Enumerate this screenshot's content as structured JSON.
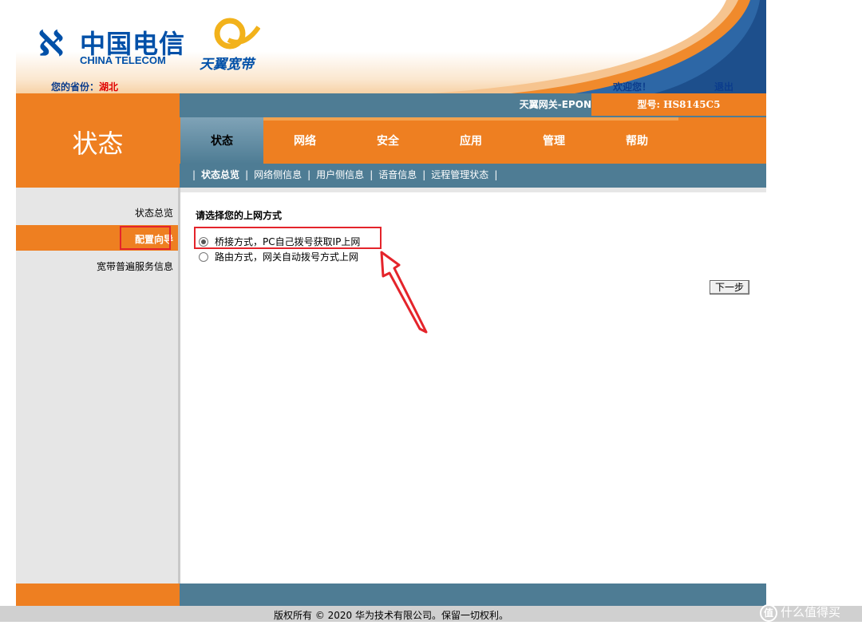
{
  "header": {
    "logo_cn": "中国电信",
    "logo_en": "CHINA TELECOM",
    "brand_text": "天翼宽带",
    "province_label": "您的省份：",
    "province_value": "湖北",
    "welcome": "欢迎您！",
    "logout": "退出"
  },
  "device": {
    "gateway_name": "天翼网关-EPON",
    "model": "型号: HS8145C5"
  },
  "section": {
    "title": "状态"
  },
  "nav": {
    "tabs": [
      {
        "label": "状态",
        "active": true
      },
      {
        "label": "网络"
      },
      {
        "label": "安全"
      },
      {
        "label": "应用"
      },
      {
        "label": "管理"
      },
      {
        "label": "帮助"
      }
    ]
  },
  "subnav": {
    "items": [
      "状态总览",
      "网络侧信息",
      "用户侧信息",
      "语音信息",
      "远程管理状态"
    ],
    "active": "状态总览"
  },
  "sidebar": {
    "items": [
      {
        "label": "状态总览"
      },
      {
        "label": "配置向导",
        "active": true
      },
      {
        "label": "宽带普遍服务信息"
      }
    ]
  },
  "content": {
    "heading": "请选择您的上网方式",
    "options": [
      {
        "label": "桥接方式，PC自己拨号获取IP上网",
        "checked": true
      },
      {
        "label": "路由方式，网关自动拨号方式上网",
        "checked": false
      }
    ],
    "next_button": "下一步"
  },
  "footer": {
    "copyright": "版权所有 © 2020 华为技术有限公司。保留一切权利。",
    "watermark": "什么值得买",
    "watermark_badge": "值"
  },
  "colors": {
    "orange": "#ee7f21",
    "steel_blue": "#4e7c94",
    "highlight_red": "#e4242b",
    "logo_blue": "#0050a8"
  }
}
